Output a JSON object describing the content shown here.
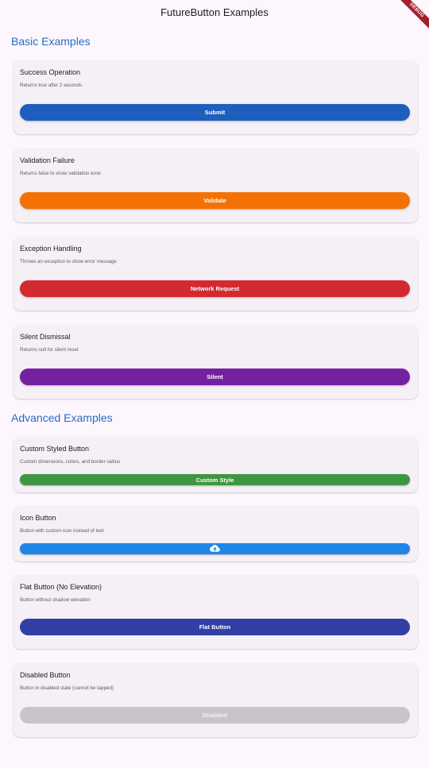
{
  "app_title": "FutureButton Examples",
  "debug_banner": "DEBUG",
  "sections": {
    "basic": {
      "title": "Basic Examples"
    },
    "advanced": {
      "title": "Advanced Examples"
    }
  },
  "cards": [
    {
      "title": "Success Operation",
      "description": "Returns true after 2 seconds",
      "button_label": "Submit",
      "color": "#1e5ebd"
    },
    {
      "title": "Validation Failure",
      "description": "Returns false to show validation error",
      "button_label": "Validate",
      "color": "#f47205"
    },
    {
      "title": "Exception Handling",
      "description": "Throws an exception to show error message",
      "button_label": "Network Request",
      "color": "#d32a2f"
    },
    {
      "title": "Silent Dismissal",
      "description": "Returns null for silent reset",
      "button_label": "Silent",
      "color": "#7421a1"
    },
    {
      "title": "Custom Styled Button",
      "description": "Custom dimensions, colors, and border radius",
      "button_label": "Custom Style",
      "color": "#3f9642"
    },
    {
      "title": "Icon Button",
      "description": "Button with custom icon instead of text",
      "button_icon": "cloud-upload-icon",
      "color": "#1f86e6"
    },
    {
      "title": "Flat Button (No Elevation)",
      "description": "Button without shadow elevation",
      "button_label": "Flat Button",
      "color": "#323fa4"
    },
    {
      "title": "Disabled Button",
      "description": "Button in disabled state (cannot be tapped)",
      "button_label": "Disabled",
      "color": "#c9c4ca"
    }
  ]
}
